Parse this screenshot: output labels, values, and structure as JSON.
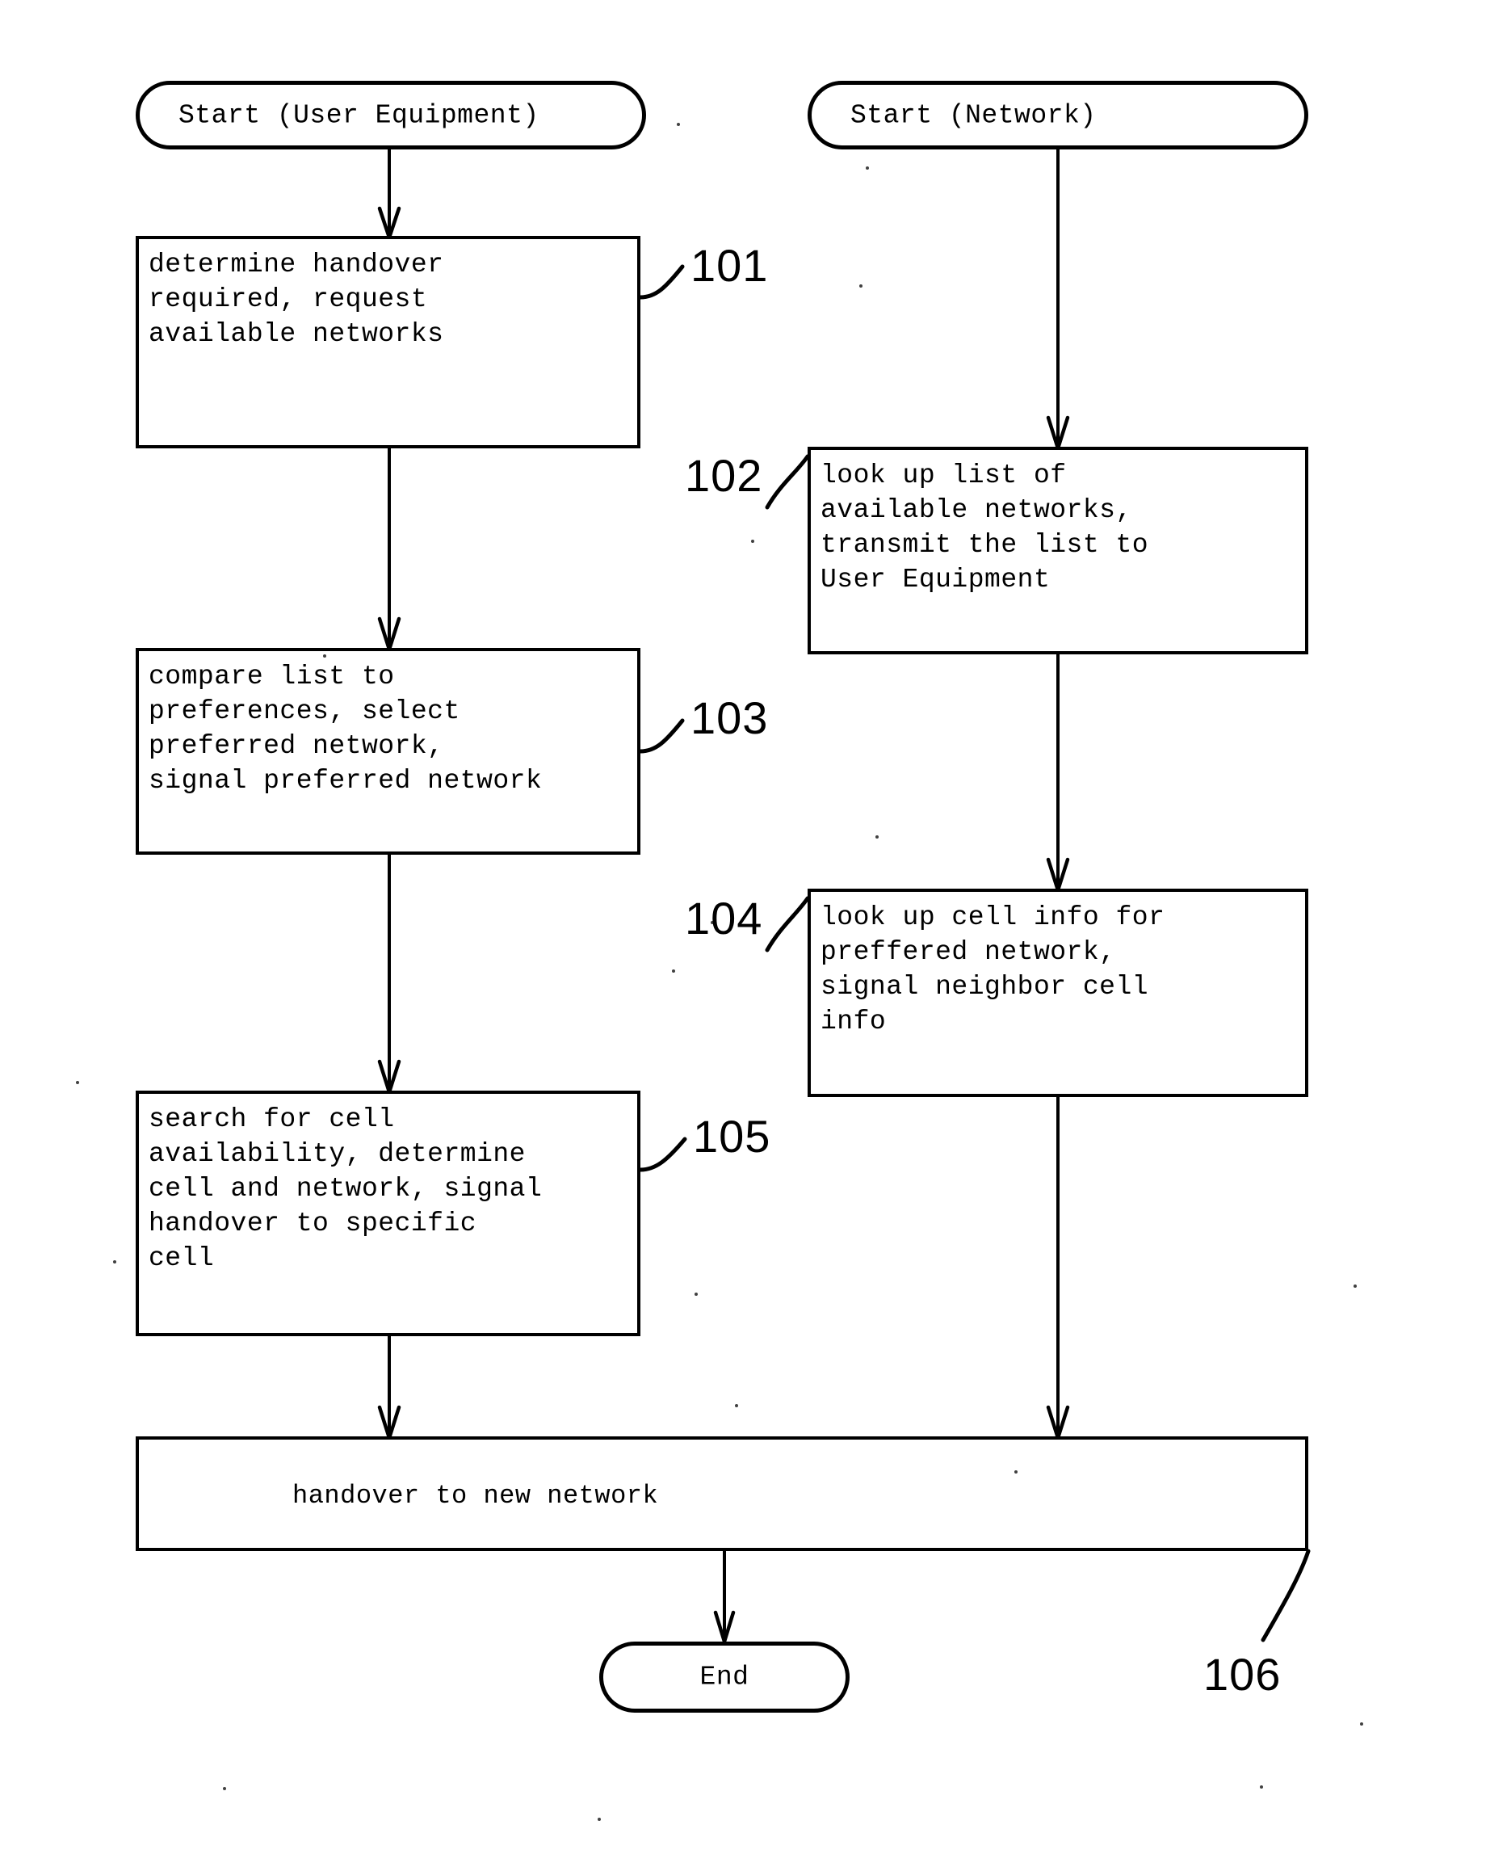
{
  "figure": {
    "type": "flowchart",
    "orientation": "two-column",
    "background_color": "#ffffff",
    "line_color": "#000000",
    "columns": [
      {
        "name": "user-equipment",
        "start_label": "Start (User Equipment)"
      },
      {
        "name": "network",
        "start_label": "Start (Network)"
      }
    ]
  },
  "nodes": {
    "start_ue": {
      "label": "Start (User Equipment)",
      "shape": "rounded-terminator"
    },
    "start_network": {
      "label": "Start (Network)",
      "shape": "rounded-terminator"
    },
    "step_101": {
      "ref": "101",
      "shape": "process",
      "lines": [
        "determine handover",
        "required, request",
        "available networks"
      ],
      "text": "determine handover\nrequired, request\navailable networks"
    },
    "step_102": {
      "ref": "102",
      "shape": "process",
      "lines": [
        "look up list of",
        "available networks,",
        "transmit the list to",
        "User Equipment"
      ],
      "text": "look up list of\navailable networks,\ntransmit the list to\nUser Equipment"
    },
    "step_103": {
      "ref": "103",
      "shape": "process",
      "lines": [
        "compare list to",
        "preferences, select",
        "preferred network,",
        "signal preferred network"
      ],
      "text": "compare list to\npreferences, select\npreferred network,\nsignal preferred network"
    },
    "step_104": {
      "ref": "104",
      "shape": "process",
      "lines": [
        "look up cell info for",
        "preffered network,",
        "signal neighbor cell",
        "info"
      ],
      "text": "look up cell info for\npreffered network,\nsignal neighbor cell\ninfo"
    },
    "step_105": {
      "ref": "105",
      "shape": "process",
      "lines": [
        "search for cell",
        "availability, determine",
        "cell and network, signal",
        "handover to specific",
        "cell"
      ],
      "text": "search for cell\navailability, determine\ncell and network, signal\nhandover to specific\ncell"
    },
    "step_106": {
      "ref": "106",
      "shape": "process",
      "lines": [
        "handover to new network"
      ],
      "text": "handover to new network"
    },
    "end": {
      "label": "End",
      "shape": "rounded-terminator"
    }
  },
  "reference_numerals": {
    "n101": "101",
    "n102": "102",
    "n103": "103",
    "n104": "104",
    "n105": "105",
    "n106": "106"
  },
  "edges": [
    {
      "from": "start_ue",
      "to": "step_101",
      "style": "arrow"
    },
    {
      "from": "step_101",
      "to": "step_103",
      "style": "arrow"
    },
    {
      "from": "step_103",
      "to": "step_105",
      "style": "arrow"
    },
    {
      "from": "step_105",
      "to": "step_106",
      "style": "arrow"
    },
    {
      "from": "start_network",
      "to": "step_102",
      "style": "arrow"
    },
    {
      "from": "step_102",
      "to": "step_104",
      "style": "arrow"
    },
    {
      "from": "step_104",
      "to": "step_106",
      "style": "arrow"
    },
    {
      "from": "step_106",
      "to": "end",
      "style": "arrow"
    }
  ]
}
